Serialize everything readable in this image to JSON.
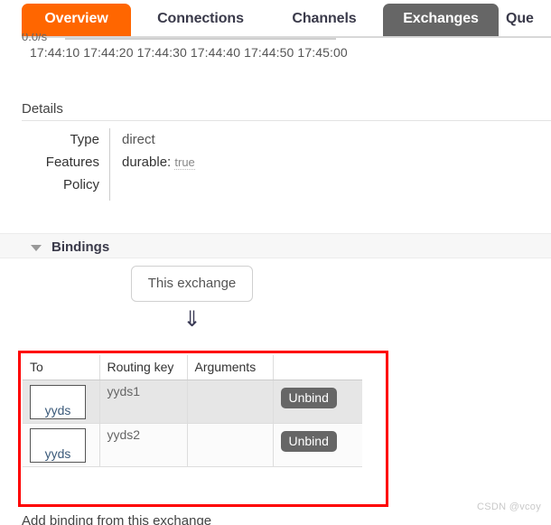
{
  "tabs": [
    {
      "label": "Overview",
      "state": "selected"
    },
    {
      "label": "Connections",
      "state": "inactive"
    },
    {
      "label": "Channels",
      "state": "inactive"
    },
    {
      "label": "Exchanges",
      "state": "current"
    },
    {
      "label": "Que",
      "state": "inactive"
    }
  ],
  "chart": {
    "y_axis_label": "0.0/s",
    "x_tick_labels": "17:44:10 17:44:20 17:44:30 17:44:40 17:44:50 17:45:00"
  },
  "details": {
    "title": "Details",
    "rows": [
      {
        "label": "Type",
        "value": "direct"
      },
      {
        "label": "Features",
        "value": ""
      },
      {
        "label": "Policy",
        "value": ""
      }
    ],
    "features": {
      "name": "durable:",
      "value": "true"
    }
  },
  "bindings": {
    "header": "Bindings",
    "caret_icon": "chevron-down-icon",
    "source_box_label": "This exchange",
    "arrow_glyph": "⇓",
    "columns": [
      "To",
      "Routing key",
      "Arguments",
      ""
    ],
    "rows": [
      {
        "to": "yyds",
        "routing_key": "yyds1",
        "arguments": "",
        "action": "Unbind"
      },
      {
        "to": "yyds",
        "routing_key": "yyds2",
        "arguments": "",
        "action": "Unbind"
      }
    ],
    "add_binding_label": "Add binding from this exchange"
  },
  "watermark": "CSDN @vcoy",
  "colors": {
    "selected_tab": "#ff6600",
    "current_tab": "#666666",
    "highlight_box": "#fe0000",
    "button": "#666666"
  }
}
